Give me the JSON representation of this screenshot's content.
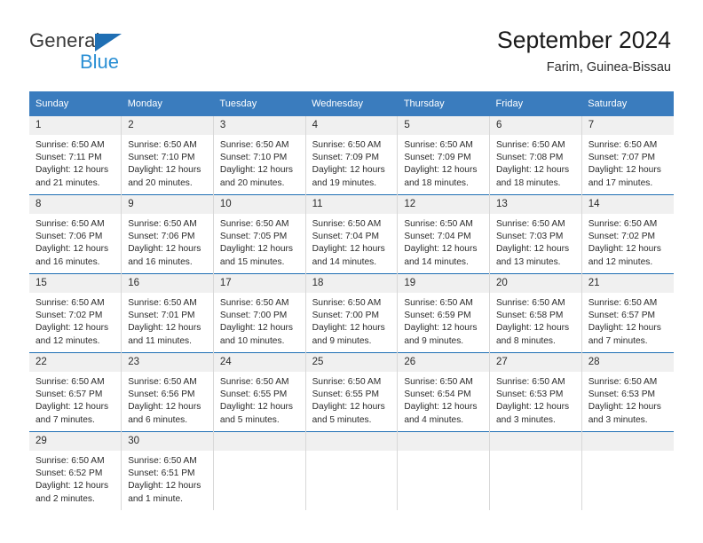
{
  "brand": {
    "name_top": "General",
    "name_bottom": "Blue",
    "accent_color": "#2a8fd4",
    "triangle_color": "#1f6fb4"
  },
  "header": {
    "title": "September 2024",
    "subtitle": "Farim, Guinea-Bissau"
  },
  "theme": {
    "header_row_bg": "#3a7cbe",
    "row_divider": "#1f6fb4",
    "daynum_bg": "#f0f0f0",
    "text": "#2b2b2b"
  },
  "weekday_headers": [
    "Sunday",
    "Monday",
    "Tuesday",
    "Wednesday",
    "Thursday",
    "Friday",
    "Saturday"
  ],
  "weeks": [
    [
      {
        "day": "1",
        "sunrise": "Sunrise: 6:50 AM",
        "sunset": "Sunset: 7:11 PM",
        "daylight_1": "Daylight: 12 hours",
        "daylight_2": "and 21 minutes."
      },
      {
        "day": "2",
        "sunrise": "Sunrise: 6:50 AM",
        "sunset": "Sunset: 7:10 PM",
        "daylight_1": "Daylight: 12 hours",
        "daylight_2": "and 20 minutes."
      },
      {
        "day": "3",
        "sunrise": "Sunrise: 6:50 AM",
        "sunset": "Sunset: 7:10 PM",
        "daylight_1": "Daylight: 12 hours",
        "daylight_2": "and 20 minutes."
      },
      {
        "day": "4",
        "sunrise": "Sunrise: 6:50 AM",
        "sunset": "Sunset: 7:09 PM",
        "daylight_1": "Daylight: 12 hours",
        "daylight_2": "and 19 minutes."
      },
      {
        "day": "5",
        "sunrise": "Sunrise: 6:50 AM",
        "sunset": "Sunset: 7:09 PM",
        "daylight_1": "Daylight: 12 hours",
        "daylight_2": "and 18 minutes."
      },
      {
        "day": "6",
        "sunrise": "Sunrise: 6:50 AM",
        "sunset": "Sunset: 7:08 PM",
        "daylight_1": "Daylight: 12 hours",
        "daylight_2": "and 18 minutes."
      },
      {
        "day": "7",
        "sunrise": "Sunrise: 6:50 AM",
        "sunset": "Sunset: 7:07 PM",
        "daylight_1": "Daylight: 12 hours",
        "daylight_2": "and 17 minutes."
      }
    ],
    [
      {
        "day": "8",
        "sunrise": "Sunrise: 6:50 AM",
        "sunset": "Sunset: 7:06 PM",
        "daylight_1": "Daylight: 12 hours",
        "daylight_2": "and 16 minutes."
      },
      {
        "day": "9",
        "sunrise": "Sunrise: 6:50 AM",
        "sunset": "Sunset: 7:06 PM",
        "daylight_1": "Daylight: 12 hours",
        "daylight_2": "and 16 minutes."
      },
      {
        "day": "10",
        "sunrise": "Sunrise: 6:50 AM",
        "sunset": "Sunset: 7:05 PM",
        "daylight_1": "Daylight: 12 hours",
        "daylight_2": "and 15 minutes."
      },
      {
        "day": "11",
        "sunrise": "Sunrise: 6:50 AM",
        "sunset": "Sunset: 7:04 PM",
        "daylight_1": "Daylight: 12 hours",
        "daylight_2": "and 14 minutes."
      },
      {
        "day": "12",
        "sunrise": "Sunrise: 6:50 AM",
        "sunset": "Sunset: 7:04 PM",
        "daylight_1": "Daylight: 12 hours",
        "daylight_2": "and 14 minutes."
      },
      {
        "day": "13",
        "sunrise": "Sunrise: 6:50 AM",
        "sunset": "Sunset: 7:03 PM",
        "daylight_1": "Daylight: 12 hours",
        "daylight_2": "and 13 minutes."
      },
      {
        "day": "14",
        "sunrise": "Sunrise: 6:50 AM",
        "sunset": "Sunset: 7:02 PM",
        "daylight_1": "Daylight: 12 hours",
        "daylight_2": "and 12 minutes."
      }
    ],
    [
      {
        "day": "15",
        "sunrise": "Sunrise: 6:50 AM",
        "sunset": "Sunset: 7:02 PM",
        "daylight_1": "Daylight: 12 hours",
        "daylight_2": "and 12 minutes."
      },
      {
        "day": "16",
        "sunrise": "Sunrise: 6:50 AM",
        "sunset": "Sunset: 7:01 PM",
        "daylight_1": "Daylight: 12 hours",
        "daylight_2": "and 11 minutes."
      },
      {
        "day": "17",
        "sunrise": "Sunrise: 6:50 AM",
        "sunset": "Sunset: 7:00 PM",
        "daylight_1": "Daylight: 12 hours",
        "daylight_2": "and 10 minutes."
      },
      {
        "day": "18",
        "sunrise": "Sunrise: 6:50 AM",
        "sunset": "Sunset: 7:00 PM",
        "daylight_1": "Daylight: 12 hours",
        "daylight_2": "and 9 minutes."
      },
      {
        "day": "19",
        "sunrise": "Sunrise: 6:50 AM",
        "sunset": "Sunset: 6:59 PM",
        "daylight_1": "Daylight: 12 hours",
        "daylight_2": "and 9 minutes."
      },
      {
        "day": "20",
        "sunrise": "Sunrise: 6:50 AM",
        "sunset": "Sunset: 6:58 PM",
        "daylight_1": "Daylight: 12 hours",
        "daylight_2": "and 8 minutes."
      },
      {
        "day": "21",
        "sunrise": "Sunrise: 6:50 AM",
        "sunset": "Sunset: 6:57 PM",
        "daylight_1": "Daylight: 12 hours",
        "daylight_2": "and 7 minutes."
      }
    ],
    [
      {
        "day": "22",
        "sunrise": "Sunrise: 6:50 AM",
        "sunset": "Sunset: 6:57 PM",
        "daylight_1": "Daylight: 12 hours",
        "daylight_2": "and 7 minutes."
      },
      {
        "day": "23",
        "sunrise": "Sunrise: 6:50 AM",
        "sunset": "Sunset: 6:56 PM",
        "daylight_1": "Daylight: 12 hours",
        "daylight_2": "and 6 minutes."
      },
      {
        "day": "24",
        "sunrise": "Sunrise: 6:50 AM",
        "sunset": "Sunset: 6:55 PM",
        "daylight_1": "Daylight: 12 hours",
        "daylight_2": "and 5 minutes."
      },
      {
        "day": "25",
        "sunrise": "Sunrise: 6:50 AM",
        "sunset": "Sunset: 6:55 PM",
        "daylight_1": "Daylight: 12 hours",
        "daylight_2": "and 5 minutes."
      },
      {
        "day": "26",
        "sunrise": "Sunrise: 6:50 AM",
        "sunset": "Sunset: 6:54 PM",
        "daylight_1": "Daylight: 12 hours",
        "daylight_2": "and 4 minutes."
      },
      {
        "day": "27",
        "sunrise": "Sunrise: 6:50 AM",
        "sunset": "Sunset: 6:53 PM",
        "daylight_1": "Daylight: 12 hours",
        "daylight_2": "and 3 minutes."
      },
      {
        "day": "28",
        "sunrise": "Sunrise: 6:50 AM",
        "sunset": "Sunset: 6:53 PM",
        "daylight_1": "Daylight: 12 hours",
        "daylight_2": "and 3 minutes."
      }
    ],
    [
      {
        "day": "29",
        "sunrise": "Sunrise: 6:50 AM",
        "sunset": "Sunset: 6:52 PM",
        "daylight_1": "Daylight: 12 hours",
        "daylight_2": "and 2 minutes."
      },
      {
        "day": "30",
        "sunrise": "Sunrise: 6:50 AM",
        "sunset": "Sunset: 6:51 PM",
        "daylight_1": "Daylight: 12 hours",
        "daylight_2": "and 1 minute."
      },
      {
        "day": "",
        "sunrise": "",
        "sunset": "",
        "daylight_1": "",
        "daylight_2": ""
      },
      {
        "day": "",
        "sunrise": "",
        "sunset": "",
        "daylight_1": "",
        "daylight_2": ""
      },
      {
        "day": "",
        "sunrise": "",
        "sunset": "",
        "daylight_1": "",
        "daylight_2": ""
      },
      {
        "day": "",
        "sunrise": "",
        "sunset": "",
        "daylight_1": "",
        "daylight_2": ""
      },
      {
        "day": "",
        "sunrise": "",
        "sunset": "",
        "daylight_1": "",
        "daylight_2": ""
      }
    ]
  ]
}
